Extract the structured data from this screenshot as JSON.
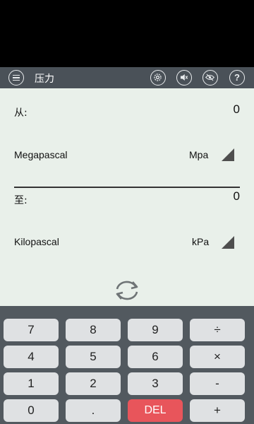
{
  "app": {
    "title": "压力"
  },
  "header_icons": [
    "settings-icon",
    "sound-off-icon",
    "eye-off-icon",
    "help-icon"
  ],
  "header": {
    "help_label": "?"
  },
  "from": {
    "label": "从:",
    "value": "0",
    "unit_name": "Megapascal",
    "unit_abbr": "Mpa"
  },
  "to": {
    "label": "至:",
    "value": "0",
    "unit_name": "Kilopascal",
    "unit_abbr": "kPa"
  },
  "keys": {
    "k7": "7",
    "k8": "8",
    "k9": "9",
    "div": "÷",
    "k4": "4",
    "k5": "5",
    "k6": "6",
    "mul": "×",
    "k1": "1",
    "k2": "2",
    "k3": "3",
    "sub": "-",
    "k0": "0",
    "dot": ".",
    "del": "DEL",
    "add": "+"
  },
  "colors": {
    "appbar": "#4a5158",
    "panel": "#e9f0ea",
    "keypad": "#52595f",
    "key": "#dfe1e3",
    "del": "#e8555b"
  }
}
